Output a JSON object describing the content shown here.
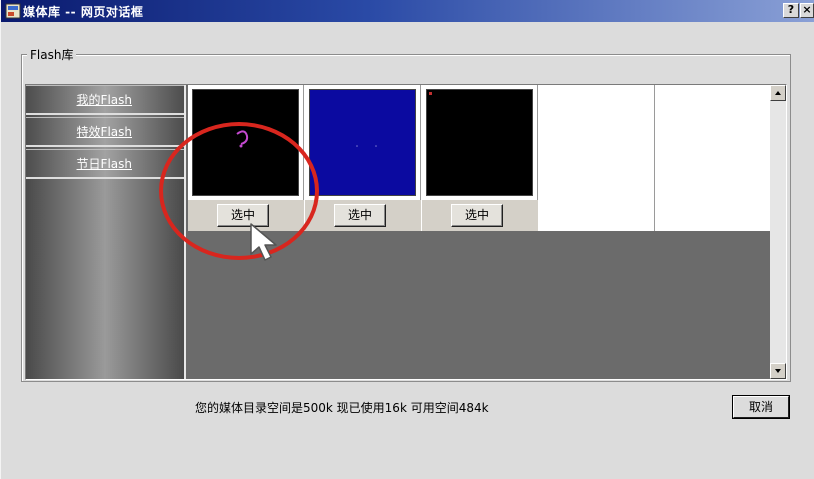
{
  "window": {
    "title": "媒体库 -- 网页对话框",
    "help_label": "?",
    "close_label": "×"
  },
  "group": {
    "legend": "Flash库"
  },
  "sidebar": {
    "items": [
      {
        "label": "我的Flash"
      },
      {
        "label": "特效Flash"
      },
      {
        "label": "节日Flash"
      }
    ]
  },
  "thumbnails": [
    {
      "button_label": "选中",
      "image_bg": "#000000"
    },
    {
      "button_label": "选中",
      "image_bg": "#0b0aa0"
    },
    {
      "button_label": "选中",
      "image_bg": "#000000"
    }
  ],
  "status_text": "您的媒体目录空间是500k  现已使用16k  可用空间484k",
  "cancel_label": "取消",
  "colors": {
    "title_bar": "#0a1a6e",
    "annotation": "#d8261e",
    "panel_bg": "#6b6b6b"
  }
}
